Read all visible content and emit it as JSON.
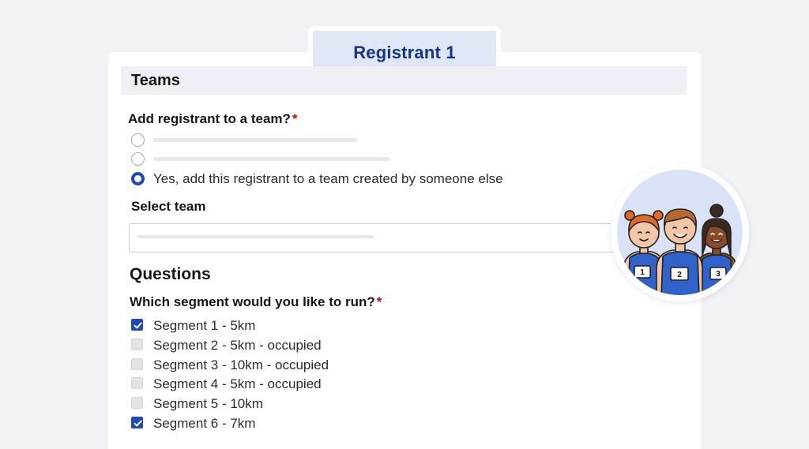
{
  "registrant": {
    "title": "Registrant 1"
  },
  "teams": {
    "section_title": "Teams",
    "add_question": "Add registrant to a team?",
    "required_mark": "*",
    "options": [
      {
        "label": "",
        "selected": false
      },
      {
        "label": "",
        "selected": false
      },
      {
        "label": "Yes, add this registrant to a team created by someone else",
        "selected": true
      }
    ],
    "select_label": "Select team",
    "select_value": ""
  },
  "questions": {
    "heading": "Questions",
    "segment_question": "Which segment would you like to run?",
    "required_mark": "*",
    "segments": [
      {
        "label": "Segment 1 - 5km",
        "checked": true,
        "disabled": false
      },
      {
        "label": "Segment 2 - 5km - occupied",
        "checked": false,
        "disabled": true
      },
      {
        "label": "Segment 3 - 10km - occupied",
        "checked": false,
        "disabled": true
      },
      {
        "label": "Segment 4 - 5km - occupied",
        "checked": false,
        "disabled": true
      },
      {
        "label": "Segment 5 - 10km",
        "checked": false,
        "disabled": false
      },
      {
        "label": "Segment 6 - 7km",
        "checked": true,
        "disabled": false
      }
    ]
  },
  "illustration": {
    "icon": "runners-team-icon",
    "bibs": [
      "1",
      "2",
      "3"
    ]
  },
  "colors": {
    "accent": "#1f49b8",
    "title_text": "#143482",
    "required": "#b01218",
    "background": "#f1f2f6"
  }
}
